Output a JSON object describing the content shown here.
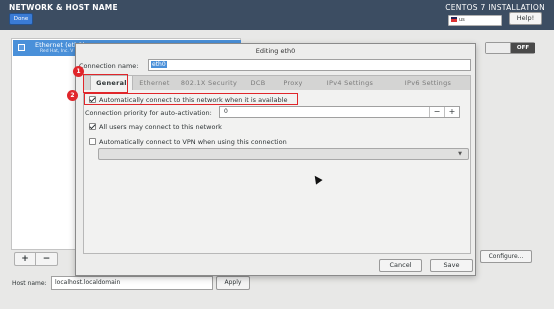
{
  "header": {
    "title": "NETWORK & HOST NAME",
    "done_label": "Done",
    "installation": "CENTOS 7 INSTALLATION",
    "keyboard": "us",
    "help_label": "Help!"
  },
  "device_list": {
    "selected": {
      "name": "Ethernet (eth0)",
      "vendor": "Red Hat, Inc. V"
    },
    "add_label": "+",
    "remove_label": "−"
  },
  "toggle": {
    "state_label": "OFF"
  },
  "configure_label": "Configure...",
  "host": {
    "label": "Host name:",
    "value": "localhost.localdomain",
    "apply_label": "Apply"
  },
  "dialog": {
    "title": "Editing eth0",
    "connection_name_label": "Connection name:",
    "connection_name_value": "eth0",
    "tabs": [
      "General",
      "Ethernet",
      "802.1X Security",
      "DCB",
      "Proxy",
      "IPv4 Settings",
      "IPv6 Settings"
    ],
    "active_tab": "General",
    "auto_connect": {
      "label": "Automatically connect to this network when it is available",
      "checked": true
    },
    "priority": {
      "label": "Connection priority for auto-activation:",
      "value": "0",
      "minus": "−",
      "plus": "+"
    },
    "all_users": {
      "label": "All users may connect to this network",
      "checked": true
    },
    "vpn": {
      "label": "Automatically connect to VPN when using this connection",
      "checked": false
    },
    "cancel_label": "Cancel",
    "save_label": "Save"
  },
  "annotations": {
    "badge_1": "1",
    "badge_2": "2"
  },
  "colors": {
    "header_bg": "#3c4d62",
    "selection": "#4a90d9",
    "annotation_red": "#e0262b"
  }
}
